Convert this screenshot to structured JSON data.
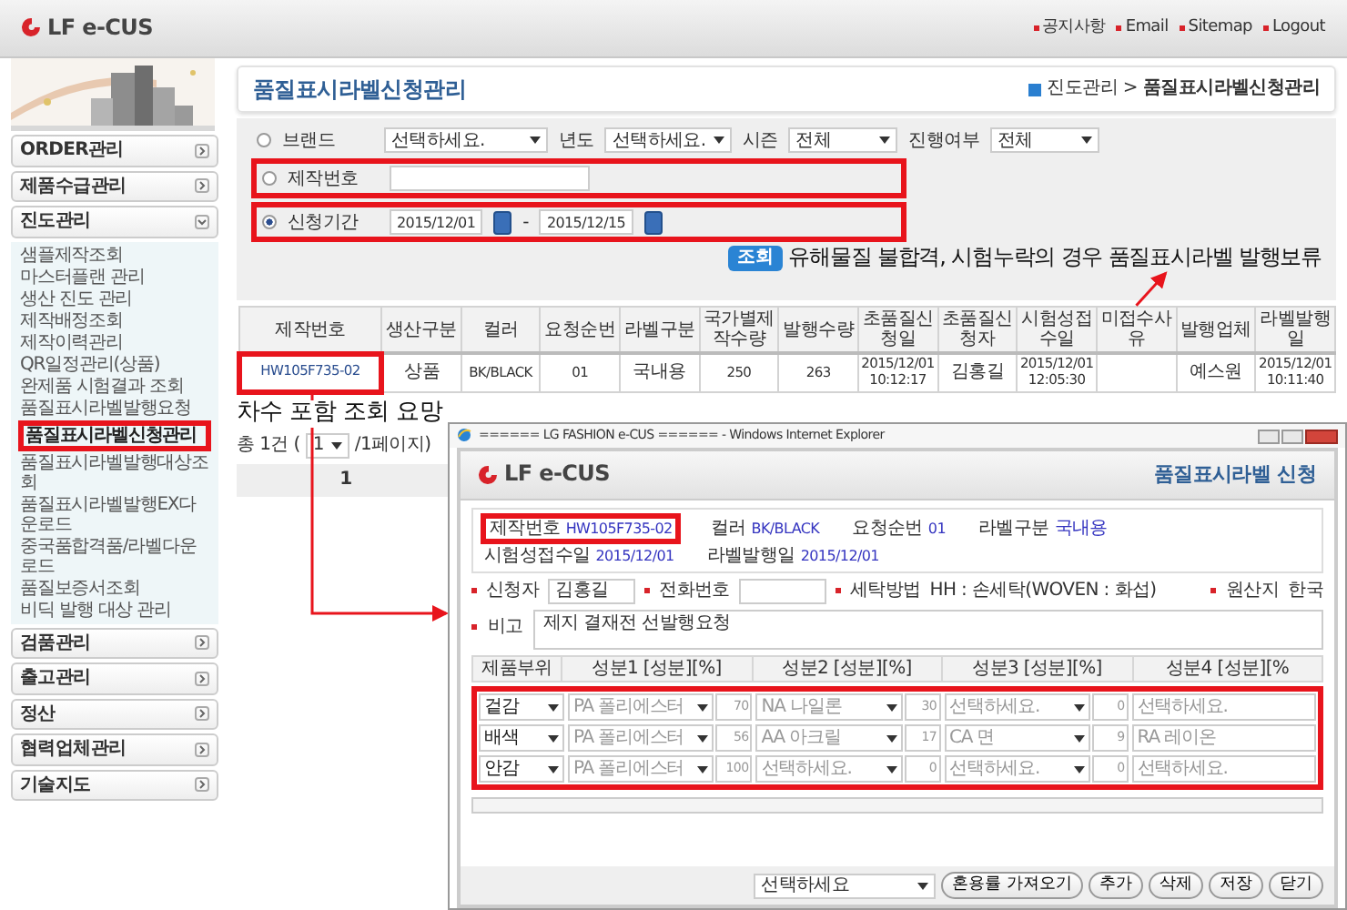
{
  "header": {
    "logo": "LF e-CUS",
    "links": [
      "공지사항",
      "Email",
      "Sitemap",
      "Logout"
    ]
  },
  "sidebar": {
    "groups": [
      {
        "label": "ORDER관리",
        "expanded": false
      },
      {
        "label": "제품수급관리",
        "expanded": false
      },
      {
        "label": "진도관리",
        "expanded": true,
        "items": [
          {
            "label": "샘플제작조회",
            "selected": false
          },
          {
            "label": "마스터플랜 관리",
            "selected": false
          },
          {
            "label": "생산 진도 관리",
            "selected": false
          },
          {
            "label": "제작배정조회",
            "selected": false
          },
          {
            "label": "제작이력관리",
            "selected": false
          },
          {
            "label": "QR일정관리(상품)",
            "selected": false
          },
          {
            "label": "완제품 시험결과 조회",
            "selected": false
          },
          {
            "label": "품질표시라벨발행요청",
            "selected": false
          },
          {
            "label": "품질표시라벨신청관리",
            "selected": true
          },
          {
            "label": "품질표시라벨발행대상조회",
            "selected": false
          },
          {
            "label": "품질표시라벨발행EX다운로드",
            "selected": false
          },
          {
            "label": "중국품합격품/라벨다운로드",
            "selected": false
          },
          {
            "label": "품질보증서조회",
            "selected": false
          },
          {
            "label": "비딕 발행 대상 관리",
            "selected": false
          }
        ]
      },
      {
        "label": "검품관리",
        "expanded": false
      },
      {
        "label": "출고관리",
        "expanded": false
      },
      {
        "label": "정산",
        "expanded": false
      },
      {
        "label": "협력업체관리",
        "expanded": false
      },
      {
        "label": "기술지도",
        "expanded": false
      }
    ]
  },
  "page": {
    "title": "품질표시라벨신청관리",
    "breadcrumb": {
      "parent": "진도관리 >",
      "current": "품질표시라벨신청관리"
    }
  },
  "search": {
    "criteria": [
      {
        "kind": "filters",
        "label": "브랜드",
        "selected": false,
        "highlighted": false,
        "value": "선택하세요.",
        "extras": [
          {
            "label": "년도",
            "value": "선택하세요."
          },
          {
            "label": "시즌",
            "value": "전체"
          },
          {
            "label": "진행여부",
            "value": "전체"
          }
        ]
      },
      {
        "kind": "text",
        "label": "제작번호",
        "selected": false,
        "highlighted": true
      },
      {
        "kind": "range",
        "label": "신청기간",
        "selected": true,
        "highlighted": true,
        "from": "2015/12/01",
        "separator": "-",
        "to": "2015/12/15"
      }
    ],
    "button": "조회",
    "note": "유해물질 불합격, 시험누락의 경우 품질표시라벨 발행보류"
  },
  "table": {
    "columns": [
      "제작번호",
      "생산구분",
      "컬러",
      "요청순번",
      "라벨구분",
      "국가별제작수량",
      "발행수량",
      "초품질신청일",
      "초품질신청자",
      "시험성접수일",
      "미접수사유",
      "발행업체",
      "라벨발행일"
    ],
    "rows": [
      {
        "cells": [
          "HW105F735-02",
          "상품",
          "BK/BLACK",
          "01",
          "국내용",
          "250",
          "263",
          "2015/12/01 10:12:17",
          "김홍길",
          "2015/12/01 12:05:30",
          null,
          "예스원",
          "2015/12/01 10:11:40"
        ],
        "highlighted": true
      }
    ]
  },
  "row_note": "차수 포함 조회 요망",
  "pagination": {
    "total": "총 1건 (",
    "page": "1",
    "suffix": "/1페이지)",
    "pages": [
      {
        "label": "1",
        "selected": true
      }
    ]
  },
  "popup": {
    "window_title": "====== LG FASHION e-CUS ====== - Windows Internet Explorer",
    "logo": "LF e-CUS",
    "title": "품질표시라벨 신청",
    "info": [
      {
        "label": "제작번호",
        "value": "HW105F735-02",
        "highlighted": true
      },
      {
        "label": "컬러",
        "value": "BK/BLACK",
        "highlighted": false
      },
      {
        "label": "요청순번",
        "value": "01",
        "highlighted": false
      },
      {
        "label": "라벨구분",
        "value": "국내용",
        "highlighted": false
      },
      {
        "label": "시험성접수일",
        "value": "2015/12/01",
        "highlighted": false
      },
      {
        "label": "라벨발행일",
        "value": "2015/12/01",
        "highlighted": false
      }
    ],
    "fields": [
      {
        "kind": "input",
        "label": "신청자",
        "value": "김홍길"
      },
      {
        "kind": "input",
        "label": "전화번호"
      },
      {
        "kind": "text",
        "label": "세탁방법",
        "value": "HH : 손세탁(WOVEN : 화섭)"
      },
      {
        "kind": "text",
        "label": "원산지",
        "value": "한국"
      }
    ],
    "remark": {
      "label": "비고",
      "value": "제지 결재전 선발행요청"
    },
    "composition": {
      "highlighted": true,
      "columns": [
        "제품부위",
        "성분1 [성분][%]",
        "성분2 [성분][%]",
        "성분3 [성분][%]",
        "성분4 [성분][%"
      ],
      "rows": [
        {
          "part": "겉감",
          "components": [
            {
              "material": "PA 폴리에스터",
              "percent": "70"
            },
            {
              "material": "NA 나일론",
              "percent": "30"
            },
            {
              "material": "선택하세요.",
              "percent": "0"
            },
            {
              "material": "선택하세요."
            }
          ]
        },
        {
          "part": "배색",
          "components": [
            {
              "material": "PA 폴리에스터",
              "percent": "56"
            },
            {
              "material": "AA 아크릴",
              "percent": "17"
            },
            {
              "material": "CA 면",
              "percent": "9"
            },
            {
              "material": "RA 레이온"
            }
          ]
        },
        {
          "part": "안감",
          "components": [
            {
              "material": "PA 폴리에스터",
              "percent": "100"
            },
            {
              "material": "선택하세요.",
              "percent": "0"
            },
            {
              "material": "선택하세요.",
              "percent": "0"
            },
            {
              "material": "선택하세요."
            }
          ]
        }
      ]
    },
    "footer": {
      "select": "선택하세요",
      "buttons": [
        "혼용률 가져오기",
        "추가",
        "삭제",
        "저장",
        "닫기"
      ]
    }
  }
}
